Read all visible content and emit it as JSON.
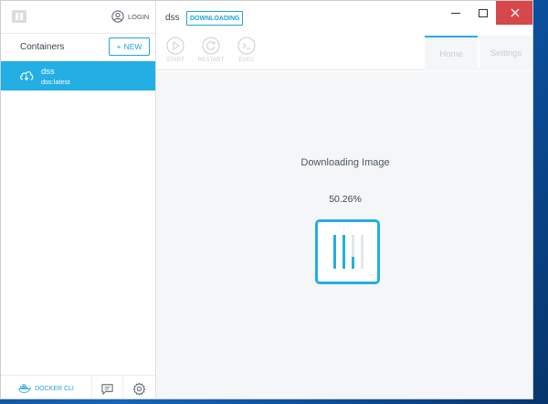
{
  "app": {
    "login_label": "LOGIN"
  },
  "sidebar": {
    "containers_title": "Containers",
    "new_button_label": "NEW",
    "items": [
      {
        "name": "dss",
        "image": "dss:latest",
        "selected": true
      }
    ],
    "bottom": {
      "docker_cli_label": "DOCKER CLI"
    }
  },
  "main": {
    "container_name": "dss",
    "status_badge": "DOWNLOADING",
    "toolbar": {
      "start_label": "START",
      "restart_label": "RESTART",
      "exec_label": "EXEC"
    },
    "tabs": [
      {
        "label": "Home",
        "active": true
      },
      {
        "label": "Settings",
        "active": false
      }
    ],
    "download": {
      "title": "Downloading Image",
      "percent_text": "50.26%",
      "layers": [
        1.0,
        1.0,
        0.35,
        0.0
      ]
    }
  },
  "colors": {
    "accent": "#23aee4",
    "close_button": "#d7474a",
    "disabled": "#c7cdd2"
  }
}
